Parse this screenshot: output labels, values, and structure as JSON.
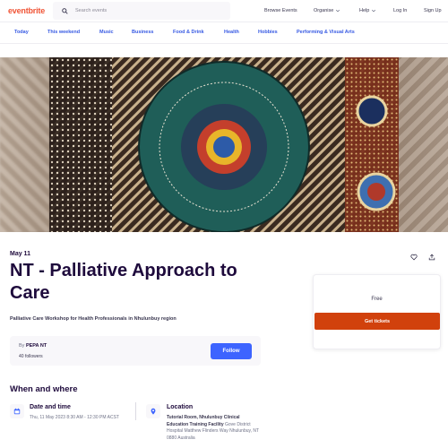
{
  "header": {
    "logo": "eventbrite",
    "search_placeholder": "Search events",
    "browse_events": "Browse Events",
    "organise": "Organise",
    "help": "Help",
    "login": "Log In",
    "signup": "Sign Up"
  },
  "categories": [
    "Today",
    "This weekend",
    "Music",
    "Business",
    "Food & Drink",
    "Health",
    "Hobbies",
    "Performing & Visual Arts"
  ],
  "hero": {
    "circle_labels": [
      "COMMUNICATION",
      "DANCING STORIES SINGING",
      "SPIRITUAL WELL-BEING",
      "PLACES OF FUNERAL BURIAL",
      "PLACE OF DEATH",
      "BODY ESCORT",
      "INTERPRETER",
      "CULTURAL MANAGEMENT",
      "INFORMED CONSENT",
      "FAMILY MEETING",
      "RIGHT STORY",
      "FIRST PERSON",
      "HEALTH VIEW",
      "CARER & ESCORT SUPPORT",
      "ECONOMIC RESOURCES",
      "RESPITE",
      "EDUCATION PALLIATIVE CULTURAL CHANGE",
      "GEOGRAPHICAL LOCATION ISSUES",
      "TRAVEL & ACCOMMODATION",
      "WOMEN'S & MEN'S BUSINESS",
      "NO NAME & NO CLOTHING",
      "GRIEF PRACTICES & SORRY BUSINESS",
      "CORONIAL INQUEST",
      "BUSH TUCKER",
      "SOCIAL HUMANITY",
      "SKIN GROUP",
      "RELIGION",
      "LIFESTYLE",
      "HISTORY",
      "LANGUAGE",
      "MEDICINE",
      "LAW",
      "DIRECTNESS",
      "TOTEMS",
      "DEPRIVATION",
      "TRADITIONAL PRACTICE",
      "VALUES & BELIEFS",
      "PATIENT & FAMILY"
    ]
  },
  "event": {
    "date": "May 11",
    "title": "NT - Palliative Approach to Care",
    "summary": "Palliative Care Workshop for Health Professionals in Nhulunbuy region",
    "organizer": {
      "by_label": "By",
      "name": "PEPA NT",
      "followers": "40 followers",
      "follow_label": "Follow"
    },
    "when_where_heading": "When and where",
    "date_time_heading": "Date and time",
    "date_time_value": "Thu, 11 May 2023 8:30 AM - 12:30 PM ACST",
    "location_heading": "Location",
    "location_name": "Tutorial Room, Nhulunbuy Clinical Education Training Facility",
    "location_address": "Gove District Hospital Matthew Flinders Way Nhulunbuy, NT 0880 Australia"
  },
  "ticket": {
    "price": "Free",
    "button": "Get tickets"
  },
  "colors": {
    "brand": "#f05537",
    "link": "#3659e3",
    "follow": "#3d64ff",
    "ticket_button": "#d1410c"
  }
}
